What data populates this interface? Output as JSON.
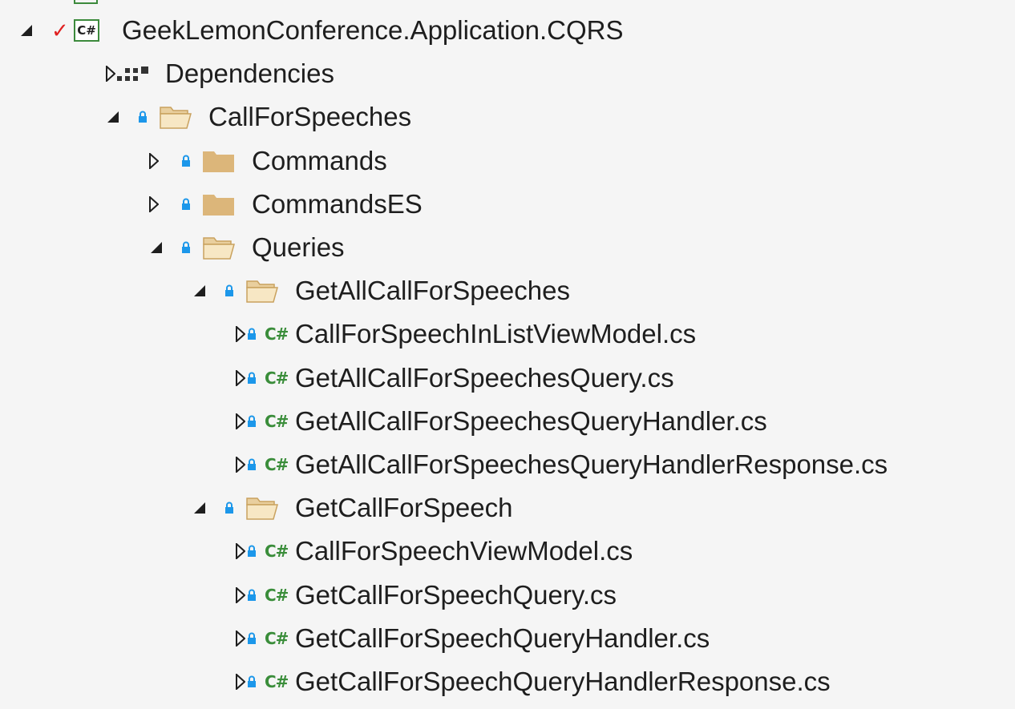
{
  "solution_explorer": {
    "clipped_row_text": "···",
    "tree": [
      {
        "label": "GeekLemonConference.Application.CQRS",
        "level": 0,
        "kind": "project",
        "expanded": true
      },
      {
        "label": "Dependencies",
        "level": 1,
        "kind": "dependencies",
        "expanded": false
      },
      {
        "label": "CallForSpeeches",
        "level": 1,
        "kind": "folder",
        "expanded": true
      },
      {
        "label": "Commands",
        "level": 2,
        "kind": "folder",
        "expanded": false
      },
      {
        "label": "CommandsES",
        "level": 2,
        "kind": "folder",
        "expanded": false
      },
      {
        "label": "Queries",
        "level": 2,
        "kind": "folder",
        "expanded": true
      },
      {
        "label": "GetAllCallForSpeeches",
        "level": 3,
        "kind": "folder",
        "expanded": true
      },
      {
        "label": "CallForSpeechInListViewModel.cs",
        "level": 4,
        "kind": "csfile",
        "expanded": false
      },
      {
        "label": "GetAllCallForSpeechesQuery.cs",
        "level": 4,
        "kind": "csfile",
        "expanded": false
      },
      {
        "label": "GetAllCallForSpeechesQueryHandler.cs",
        "level": 4,
        "kind": "csfile",
        "expanded": false
      },
      {
        "label": "GetAllCallForSpeechesQueryHandlerResponse.cs",
        "level": 4,
        "kind": "csfile",
        "expanded": false
      },
      {
        "label": "GetCallForSpeech",
        "level": 3,
        "kind": "folder",
        "expanded": true
      },
      {
        "label": "CallForSpeechViewModel.cs",
        "level": 4,
        "kind": "csfile",
        "expanded": false
      },
      {
        "label": "GetCallForSpeechQuery.cs",
        "level": 4,
        "kind": "csfile",
        "expanded": false
      },
      {
        "label": "GetCallForSpeechQueryHandler.cs",
        "level": 4,
        "kind": "csfile",
        "expanded": false
      },
      {
        "label": "GetCallForSpeechQueryHandlerResponse.cs",
        "level": 4,
        "kind": "csfile",
        "expanded": false
      }
    ]
  },
  "icons": {
    "project_badge_text": "C#",
    "csfile_badge_text": "C#",
    "check_glyph": "✓"
  },
  "colors": {
    "background": "#f5f5f5",
    "text": "#1e1e1e",
    "csharp_green": "#3a8d3a",
    "folder_fill": "#dcb67a",
    "lock_blue": "#1c97ea",
    "check_red": "#e02020"
  }
}
